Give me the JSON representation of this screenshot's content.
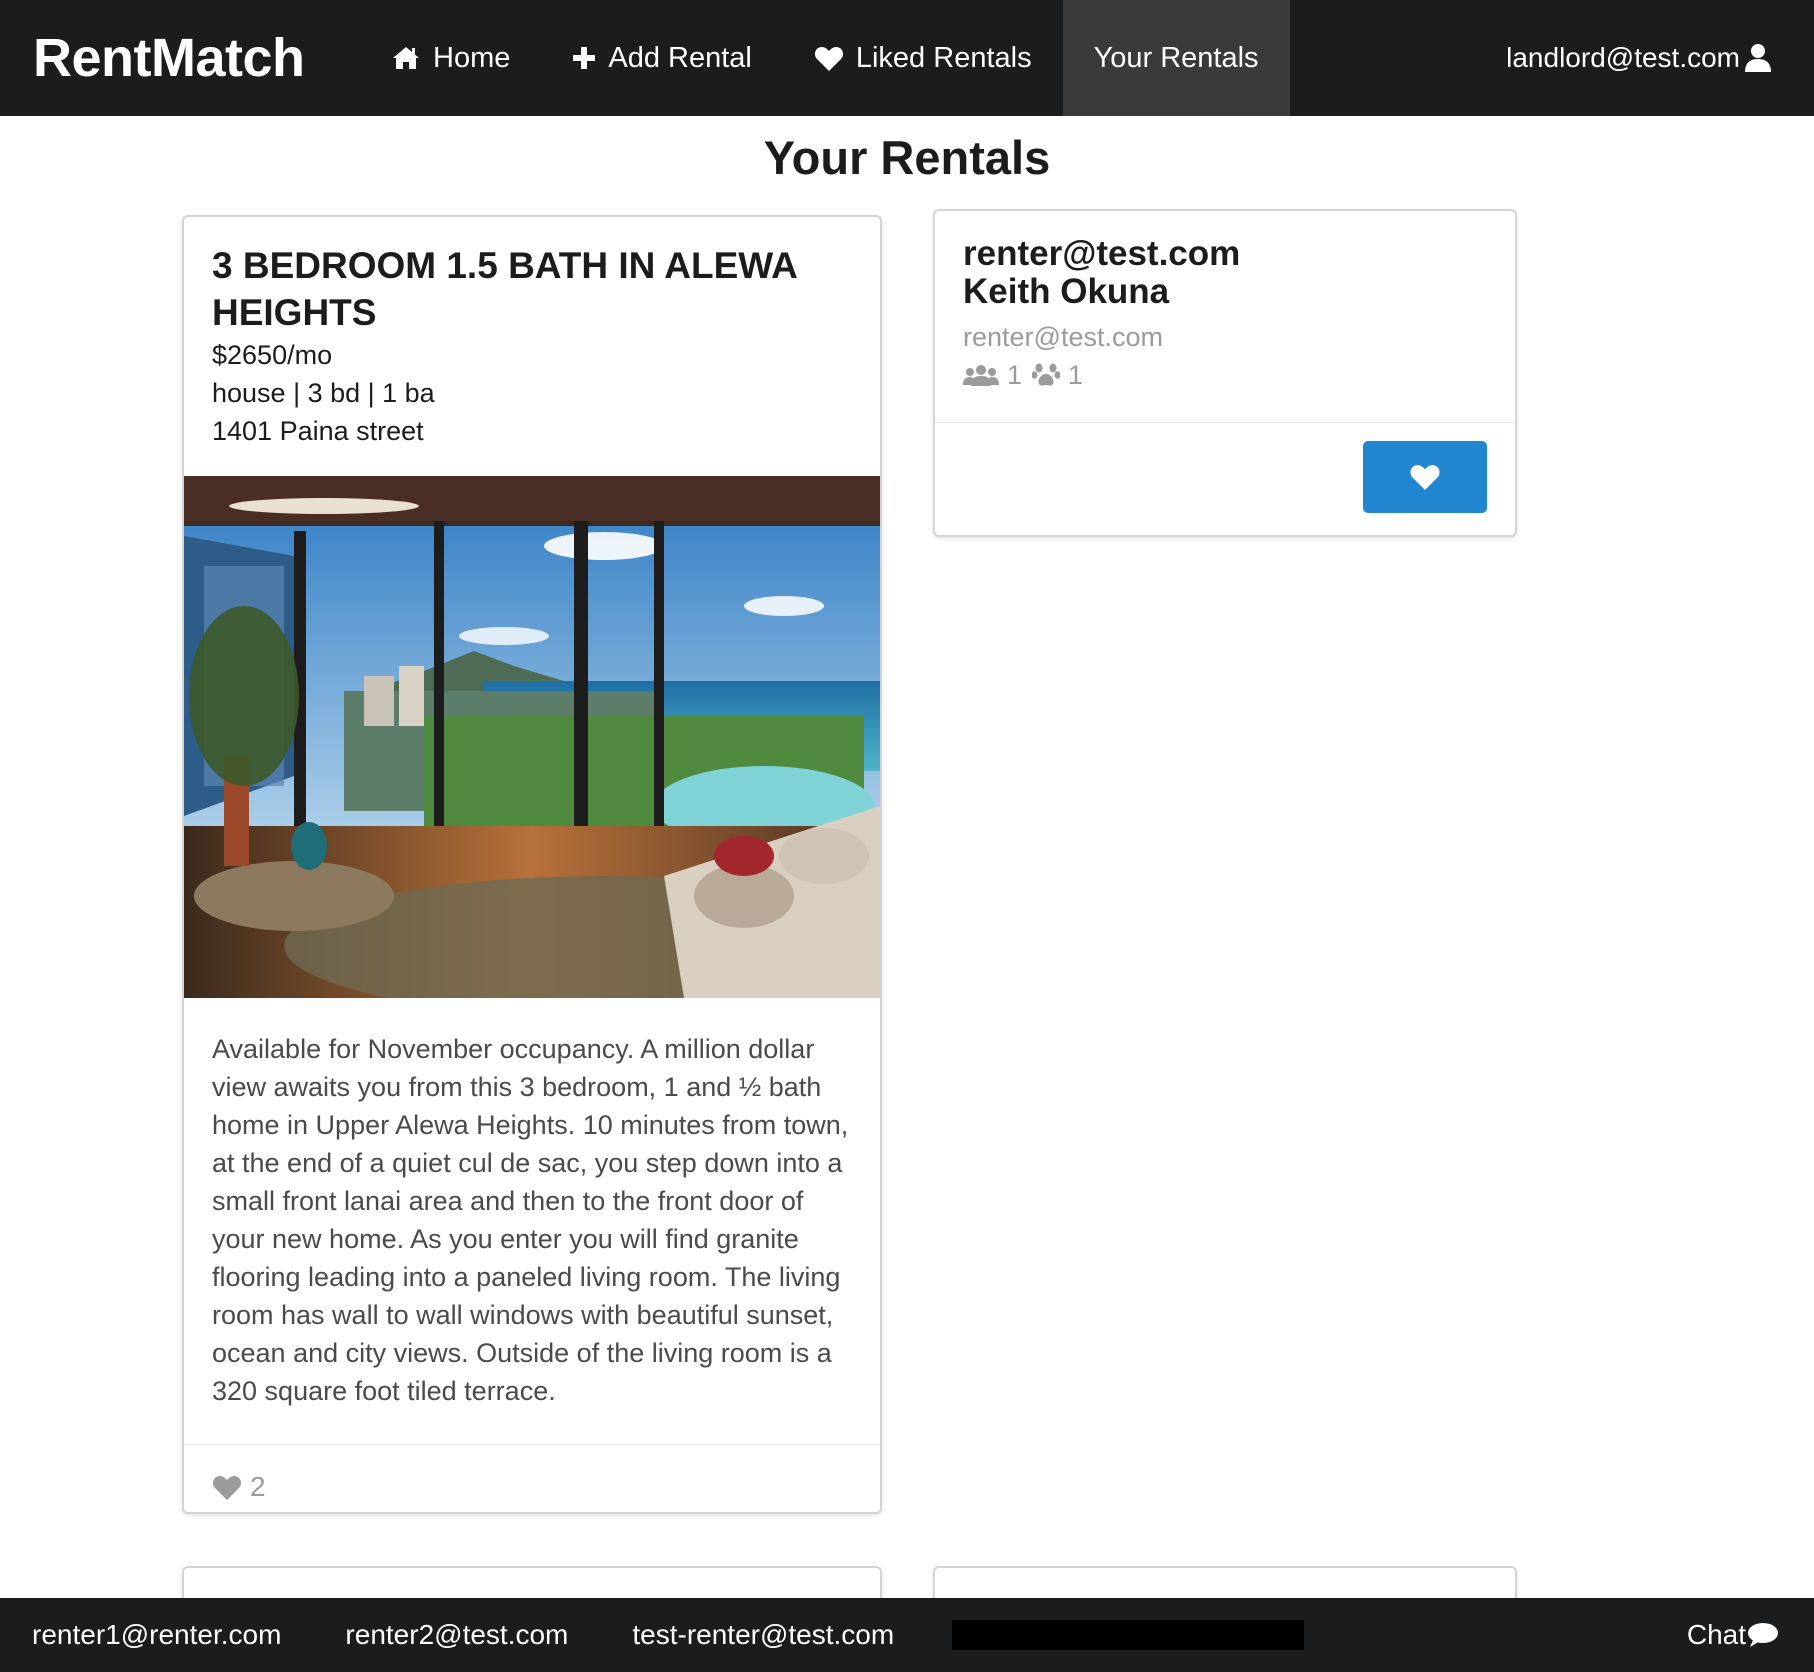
{
  "nav": {
    "brand": "RentMatch",
    "items": [
      {
        "label": "Home",
        "icon": "home-icon"
      },
      {
        "label": "Add Rental",
        "icon": "plus-icon"
      },
      {
        "label": "Liked Rentals",
        "icon": "heart-icon"
      },
      {
        "label": "Your Rentals",
        "icon": "",
        "active": true
      }
    ],
    "user_email": "landlord@test.com",
    "user_icon": "user-icon"
  },
  "page": {
    "title": "Your Rentals"
  },
  "rental": {
    "header": "3 BEDROOM 1.5 BATH IN ALEWA HEIGHTS",
    "price": "$2650/mo",
    "details": "house | 3 bd | 1 ba",
    "address": "1401 Paina street",
    "image_alt": "living room with ocean view",
    "description": "Available for November occupancy. A million dollar view awaits you from this 3 bedroom, 1 and ½ bath home in Upper Alewa Heights. 10 minutes from town, at the end of a quiet cul de sac, you step down into a small front lanai area and then to the front door of your new home. As you enter you will find granite flooring leading into a paneled living room. The living room has wall to wall windows with beautiful sunset, ocean and city views. Outside of the living room is a 320 square foot tiled terrace.",
    "likes": "2"
  },
  "renter": {
    "email_header": "renter@test.com",
    "name": "Keith Okuna",
    "email": "renter@test.com",
    "people_count": "1",
    "pet_count": "1"
  },
  "chat_bar": {
    "users": [
      "renter1@renter.com",
      "renter2@test.com",
      "test-renter@test.com"
    ],
    "toggle_label": "Chat"
  },
  "colors": {
    "nav_bg": "#1b1c1d",
    "active_nav_bg": "#3a3a3b",
    "primary_button": "#2185d0",
    "muted_text": "#9b9b9b"
  }
}
